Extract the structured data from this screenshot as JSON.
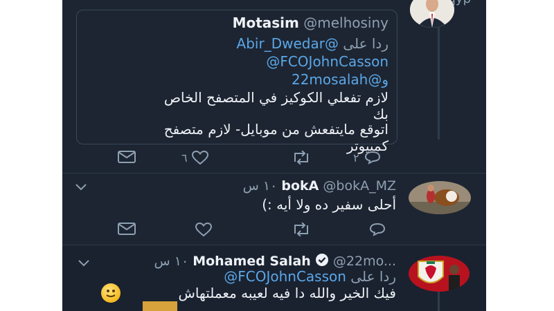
{
  "colors": {
    "background": "#1d2532",
    "link": "#5ba7e8",
    "muted": "#8fa0b2",
    "text": "#eef2f6",
    "verified": "#eef2f6"
  },
  "top_tweet": {
    "header_partial": "ıqyp",
    "quote": {
      "name": "Motasim",
      "handle": "@melhosiny",
      "reply_prefix": "ردا على",
      "mentions": [
        "@Abir_Dwedar",
        "@FCOJohnCasson",
        "@22mosalah"
      ],
      "mention_join": "و",
      "body_lines": [
        "لازم تفعلي الكوكيز في المتصفح الخاص",
        "بك",
        "اتوقع مايتفعش من موبايل- لازم متصفح",
        "كمبيوتر"
      ]
    },
    "actions": {
      "reply_count": "٢",
      "retweet_count": "",
      "like_count": "٦"
    }
  },
  "reply_boka": {
    "name": "bokA",
    "handle": "@bokA_MZ",
    "time": "١٠ س",
    "body": "أحلى سفير ده ولا أيه :)",
    "actions": {
      "reply_count": "",
      "retweet_count": "",
      "like_count": ""
    }
  },
  "reply_salah": {
    "name": "Mohamed Salah",
    "verified_icon": "verified-badge-icon",
    "handle": "@22mo...",
    "time": "١٠ س",
    "reply_prefix": "ردا على",
    "reply_to": "@FCOJohnCasson",
    "body": "فيك الخير والله دا فيه لعيبه معملتهاش"
  },
  "icons": [
    "reply-icon",
    "retweet-icon",
    "like-icon",
    "mail-icon",
    "chevron-down-icon",
    "verified-badge-icon"
  ]
}
